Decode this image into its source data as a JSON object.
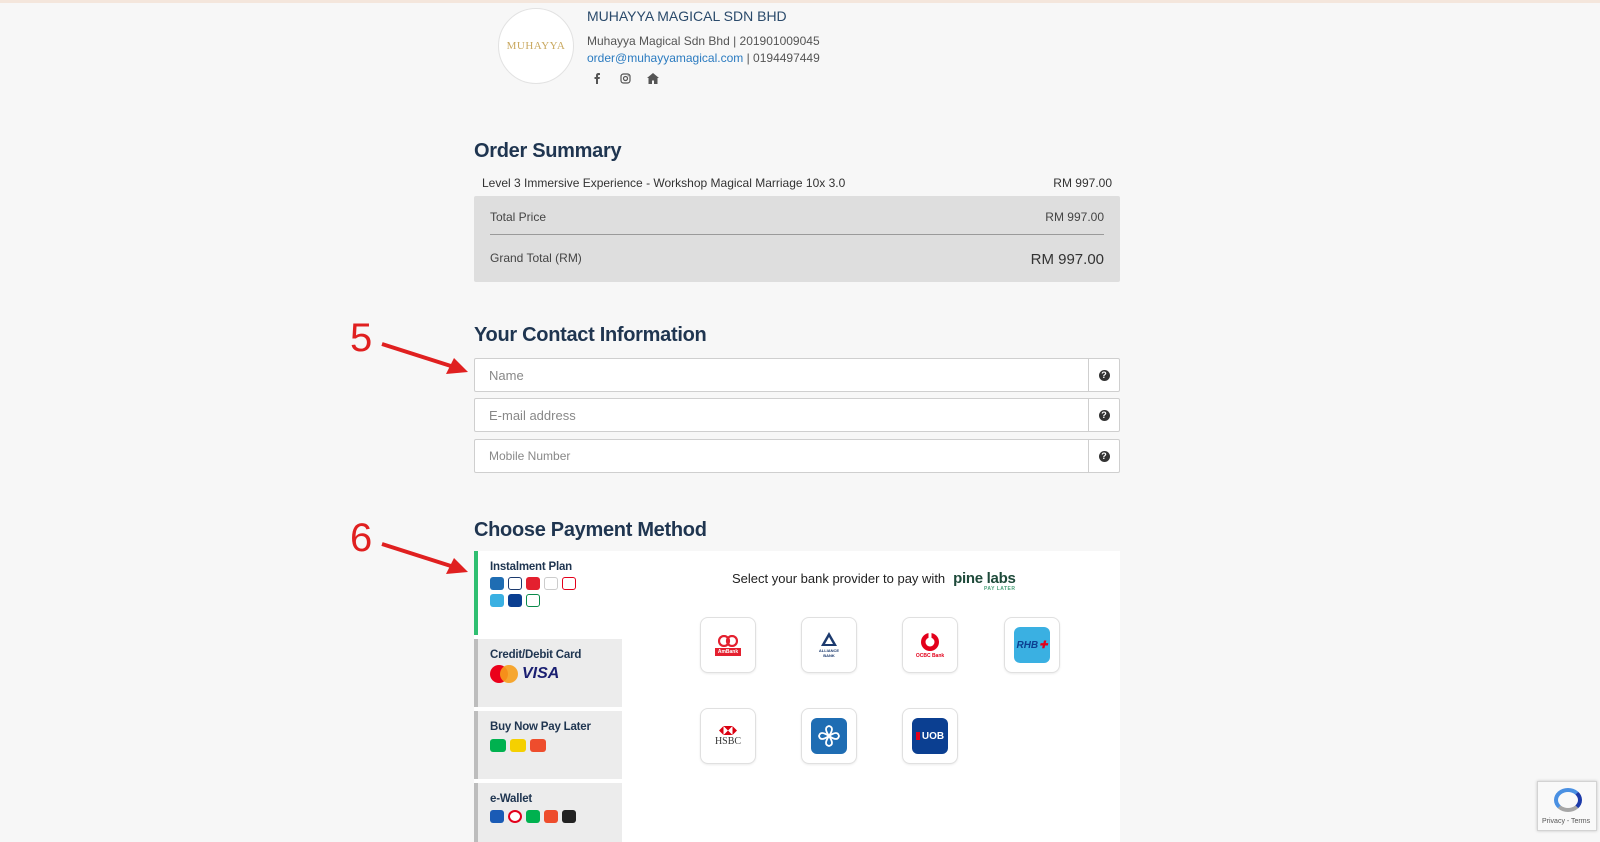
{
  "header": {
    "logo_text": "MUHAYYA",
    "company_name": "MUHAYYA MAGICAL SDN BHD",
    "registration": "Muhayya Magical Sdn Bhd | 201901009045",
    "email": "order@muhayyamagical.com",
    "phone": "| 0194497449",
    "social": {
      "facebook": "facebook-icon",
      "instagram": "instagram-icon",
      "home": "home-icon"
    }
  },
  "order_summary": {
    "title": "Order Summary",
    "item_name": "Level 3 Immersive Experience - Workshop Magical Marriage 10x 3.0",
    "item_price": "RM 997.00",
    "total_label": "Total Price",
    "total_value": "RM 997.00",
    "grand_label": "Grand Total (RM)",
    "grand_value": "RM 997.00"
  },
  "contact": {
    "title": "Your Contact Information",
    "name_placeholder": "Name",
    "email_placeholder": "E-mail address",
    "mobile_placeholder": "Mobile Number",
    "help_glyph": "?"
  },
  "annotations": {
    "five": "5",
    "six": "6",
    "color": "#e02020"
  },
  "payment": {
    "title": "Choose Payment Method",
    "tabs": [
      {
        "label": "Instalment Plan"
      },
      {
        "label": "Credit/Debit Card",
        "visa": "VISA"
      },
      {
        "label": "Buy Now Pay Later"
      },
      {
        "label": "e-Wallet"
      }
    ],
    "bank_heading": "Select your bank provider to pay with",
    "provider_brand": "pine labs",
    "provider_sub": "PAY LATER",
    "banks": [
      {
        "name": "AmBank",
        "icon": "ambank-logo-icon",
        "color": "#e4202f"
      },
      {
        "name": "ALLIANCE BANK",
        "icon": "alliance-bank-logo-icon",
        "color": "#1c3a6e"
      },
      {
        "name": "OCBC Bank",
        "icon": "ocbc-logo-icon",
        "color": "#e3001b"
      },
      {
        "name": "RHB",
        "icon": "rhb-logo-icon",
        "color": "#3ab0e2"
      },
      {
        "name": "HSBC",
        "icon": "hsbc-logo-icon",
        "color": "#db0011"
      },
      {
        "name": "Maybank",
        "icon": "bank-flower-logo-icon",
        "color": "#1f6db3"
      },
      {
        "name": "UOB",
        "icon": "uob-logo-icon",
        "color": "#0b3f91"
      }
    ]
  },
  "recaptcha": {
    "text": "Privacy - Terms"
  },
  "colors": {
    "accent_green": "#2fbf71",
    "title_navy": "#1f3550",
    "link_blue": "#2b7bc0"
  }
}
